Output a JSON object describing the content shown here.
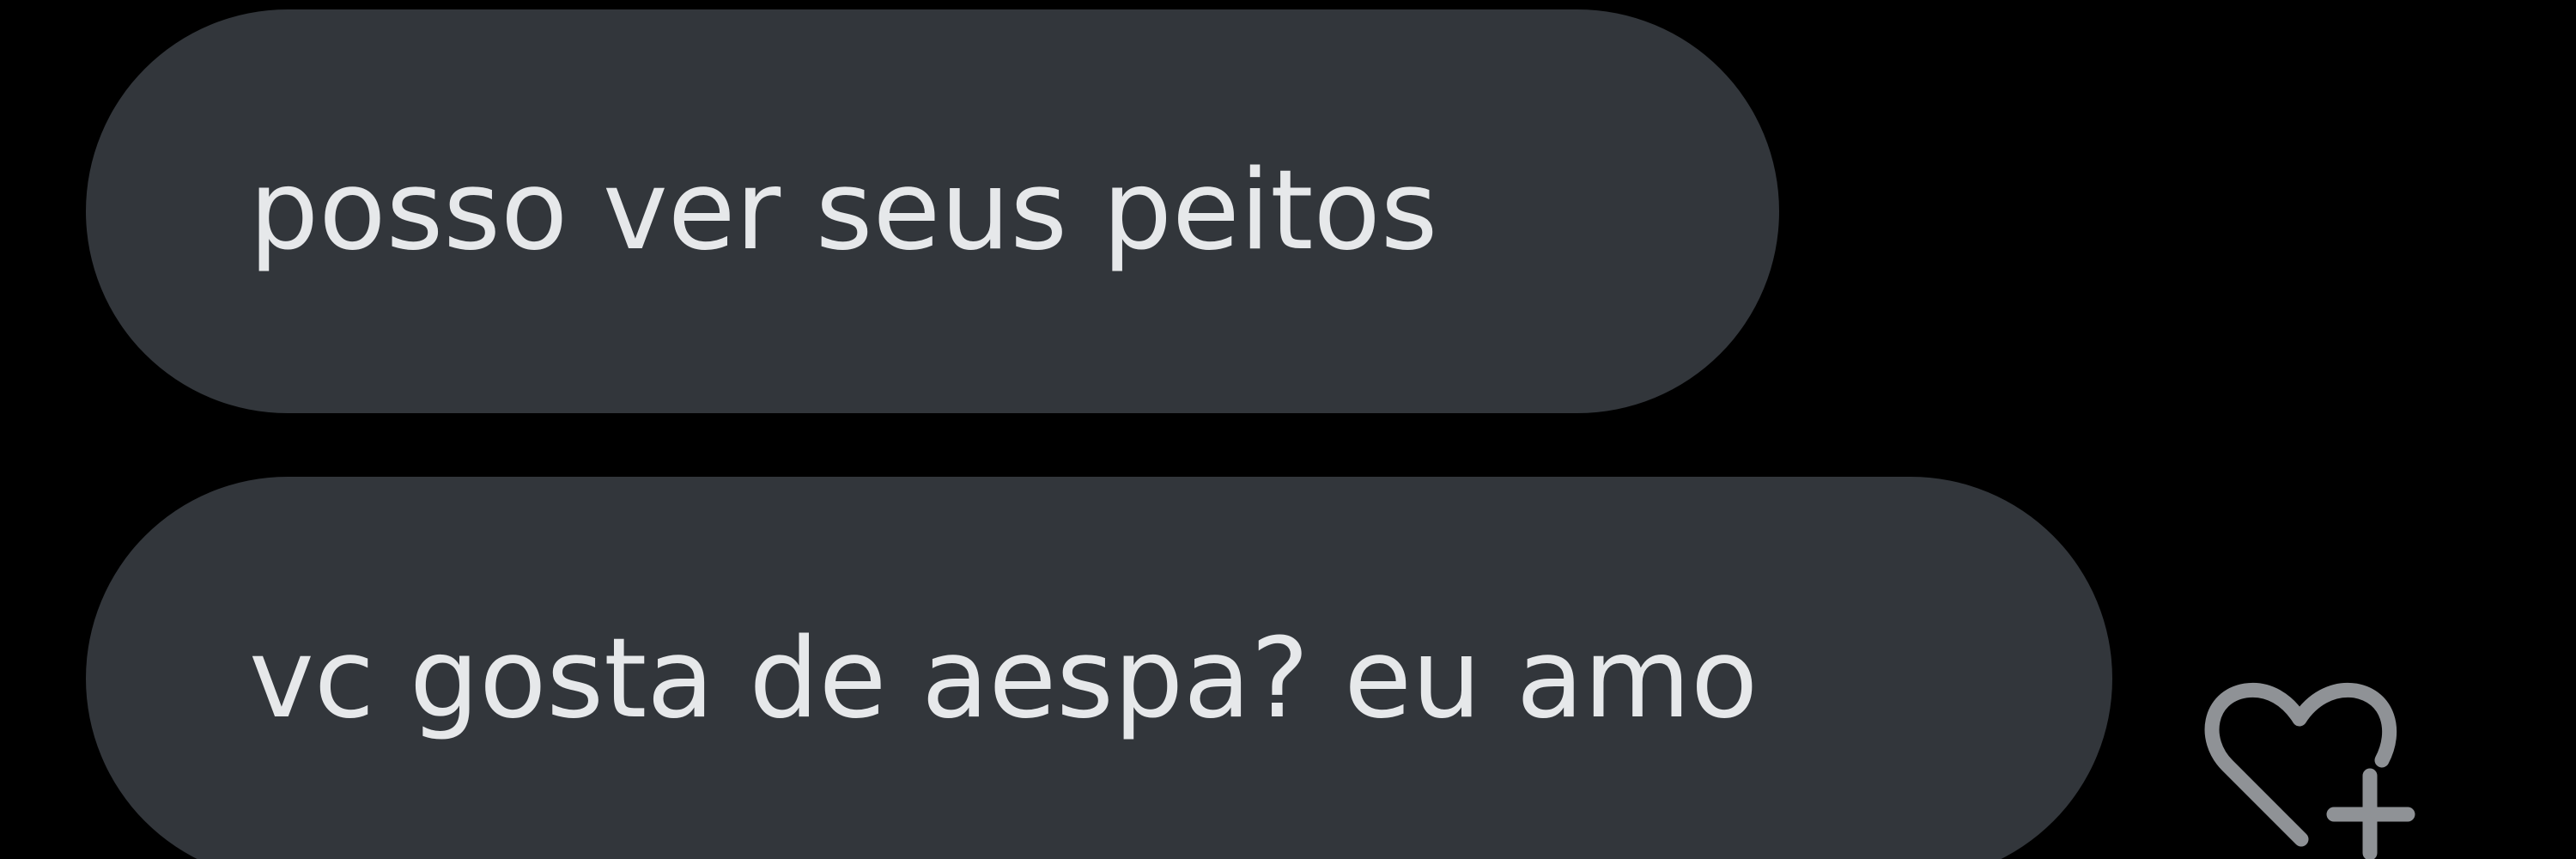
{
  "conversation": {
    "messages": [
      {
        "text": "posso ver seus peitos"
      },
      {
        "text": "vc gosta de aespa? eu amo"
      }
    ],
    "reaction_icon": "heart-plus-icon"
  },
  "colors": {
    "background": "#000000",
    "bubble": "#32363b",
    "text": "#e6e8ea",
    "icon": "#8f9296"
  }
}
